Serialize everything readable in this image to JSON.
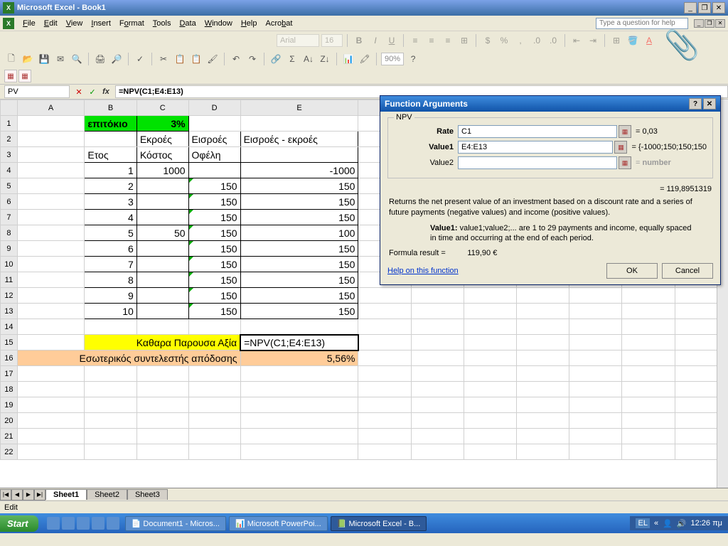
{
  "titlebar": {
    "title": "Microsoft Excel - Book1"
  },
  "menu": {
    "items": [
      "File",
      "Edit",
      "View",
      "Insert",
      "Format",
      "Tools",
      "Data",
      "Window",
      "Help",
      "Acrobat"
    ],
    "help_placeholder": "Type a question for help"
  },
  "formatting": {
    "font": "Arial",
    "size": "16",
    "zoom": "90%"
  },
  "formula_bar": {
    "name": "PV",
    "formula": "=NPV(C1;E4:E13)"
  },
  "columns": [
    "A",
    "B",
    "C",
    "D",
    "E"
  ],
  "cells": {
    "B1": "επιτόκιο",
    "C1": "3%",
    "C2": "Εκροές",
    "D2": "Εισροές",
    "E2": "Εισροές - εκροές",
    "B3": "Ετος",
    "C3": "Κόστος",
    "D3": "Οφέλη",
    "B4": "1",
    "C4": "1000",
    "E4": "-1000",
    "B5": "2",
    "D5": "150",
    "E5": "150",
    "B6": "3",
    "D6": "150",
    "E6": "150",
    "B7": "4",
    "D7": "150",
    "E7": "150",
    "B8": "5",
    "C8": "50",
    "D8": "150",
    "E8": "100",
    "B9": "6",
    "D9": "150",
    "E9": "150",
    "B10": "7",
    "D10": "150",
    "E10": "150",
    "B11": "8",
    "D11": "150",
    "E11": "150",
    "B12": "9",
    "D12": "150",
    "E12": "150",
    "B13": "10",
    "D13": "150",
    "E13": "150",
    "B15D15": "Καθαρα Παρουσα Αξία",
    "E15": "=NPV(C1;E4:E13)",
    "A16D16": "Εσωτερικός συντελεστής απόδοσης",
    "E16": "5,56%"
  },
  "sheets": {
    "active": "Sheet1",
    "tabs": [
      "Sheet1",
      "Sheet2",
      "Sheet3"
    ]
  },
  "statusbar": {
    "text": "Edit"
  },
  "dialog": {
    "title": "Function Arguments",
    "group": "NPV",
    "args": {
      "rate": {
        "label": "Rate",
        "value": "C1",
        "result": "= 0,03"
      },
      "value1": {
        "label": "Value1",
        "value": "E4:E13",
        "result": "= {-1000;150;150;150"
      },
      "value2": {
        "label": "Value2",
        "value": "",
        "result": "= number"
      }
    },
    "calc": "= 119,8951319",
    "description": "Returns the net present value of an investment based on a discount rate and a series of future payments (negative values) and income (positive values).",
    "arg_desc_label": "Value1:",
    "arg_desc": " value1;value2;... are 1 to 29 payments and income, equally spaced in time and occurring at the end of each period.",
    "formula_result_label": "Formula result =",
    "formula_result": "119,90 €",
    "help_link": "Help on this function",
    "ok": "OK",
    "cancel": "Cancel"
  },
  "taskbar": {
    "start": "Start",
    "tasks": [
      "Document1 - Micros...",
      "Microsoft PowerPoi...",
      "Microsoft Excel - B..."
    ],
    "lang": "EL",
    "clock": "12:26 πμ"
  },
  "chart_data": {
    "type": "table",
    "title": "NPV calculation",
    "interest_rate": 0.03,
    "columns": [
      "Ετος",
      "Εκροές Κόστος",
      "Εισροές Οφέλη",
      "Εισροές - εκροές"
    ],
    "rows": [
      [
        1,
        1000,
        null,
        -1000
      ],
      [
        2,
        null,
        150,
        150
      ],
      [
        3,
        null,
        150,
        150
      ],
      [
        4,
        null,
        150,
        150
      ],
      [
        5,
        50,
        150,
        100
      ],
      [
        6,
        null,
        150,
        150
      ],
      [
        7,
        null,
        150,
        150
      ],
      [
        8,
        null,
        150,
        150
      ],
      [
        9,
        null,
        150,
        150
      ],
      [
        10,
        null,
        150,
        150
      ]
    ],
    "npv_formula": "=NPV(C1;E4:E13)",
    "npv_result": 119.8951319,
    "irr": 0.0556
  }
}
